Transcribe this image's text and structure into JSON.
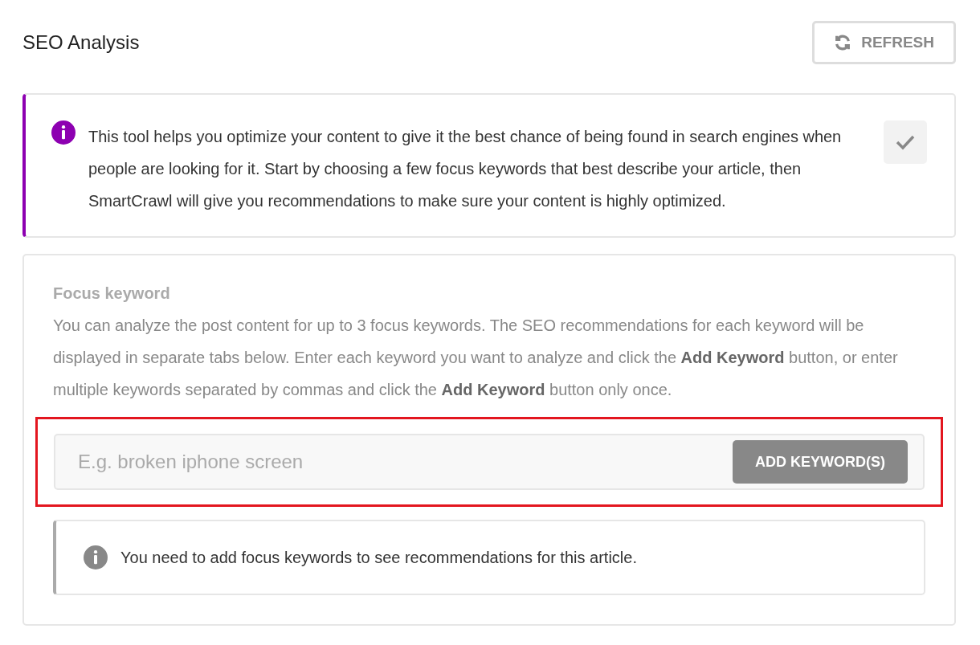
{
  "header": {
    "title": "SEO Analysis",
    "refresh_button": "REFRESH"
  },
  "intro_notice": {
    "text": "This tool helps you optimize your content to give it the best chance of being found in search engines when people are looking for it. Start by choosing a few focus keywords that best describe your article, then SmartCrawl will give you recommendations to make sure your content is highly optimized.",
    "dismissed": false
  },
  "focus_keyword": {
    "label": "Focus keyword",
    "description": "You can analyze the post content for up to 3 focus keywords. The SEO recommendations for each keyword will be displayed in separate tabs below. Enter each keyword you want to analyze and click the **Add Keyword** button, or enter multiple keywords separated by commas and click the **Add Keyword** button only once.",
    "input": {
      "placeholder": "E.g. broken iphone screen",
      "button": "ADD KEYWORD(S)",
      "highlighted": true
    },
    "notice": "You need to add focus keywords to see recommendations for this article."
  }
}
